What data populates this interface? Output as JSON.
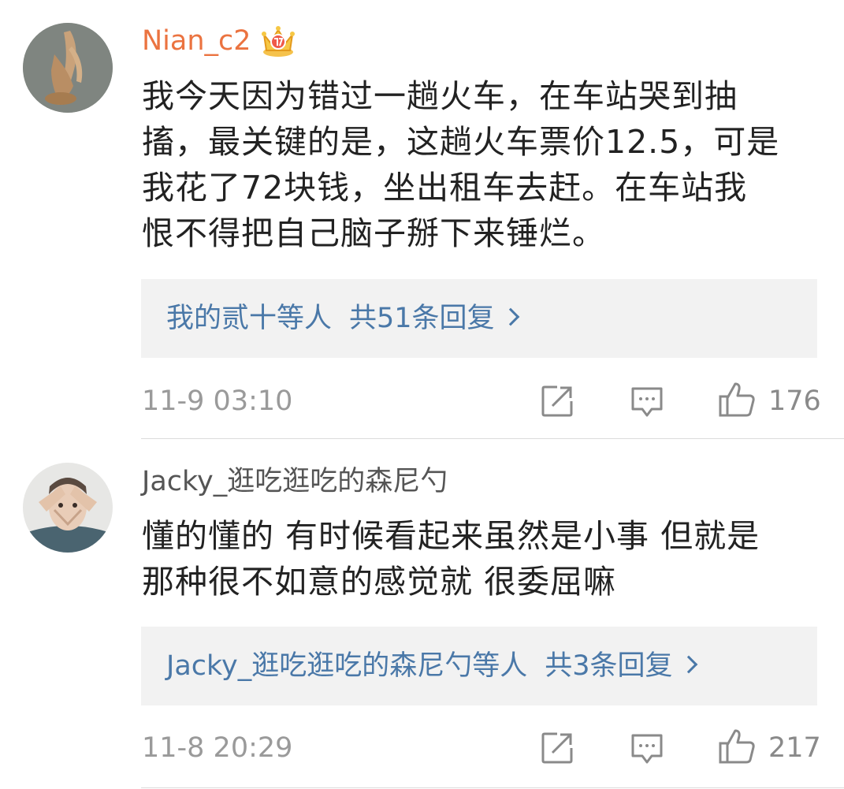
{
  "comments": [
    {
      "username": "Nian_c2",
      "badge_icon": "crown-vip-icon",
      "text_lines": [
        "我今天因为错过一趟火车，在车站哭到抽",
        "搐，最关键的是，这趟火车票价12.5，可是",
        "我花了72块钱，坐出租车去赶。在车站我",
        "恨不得把自己脑子掰下来锤烂。"
      ],
      "replies_by": "我的贰十等人",
      "replies_count": "共51条回复",
      "time": "11-9 03:10",
      "likes": "176"
    },
    {
      "username": "Jacky_逛吃逛吃的森尼勺",
      "text_lines": [
        "懂的懂的 有时候看起来虽然是小事 但就是",
        "那种很不如意的感觉就 很委屈嘛"
      ],
      "replies_by": "Jacky_逛吃逛吃的森尼勺等人",
      "replies_count": "共3条回复",
      "time": "11-8 20:29",
      "likes": "217"
    }
  ],
  "colors": {
    "vip_name": "#eb7340",
    "reply_link": "#4a78a8",
    "meta": "#9a9a9a",
    "reply_bg": "#f2f2f2"
  }
}
